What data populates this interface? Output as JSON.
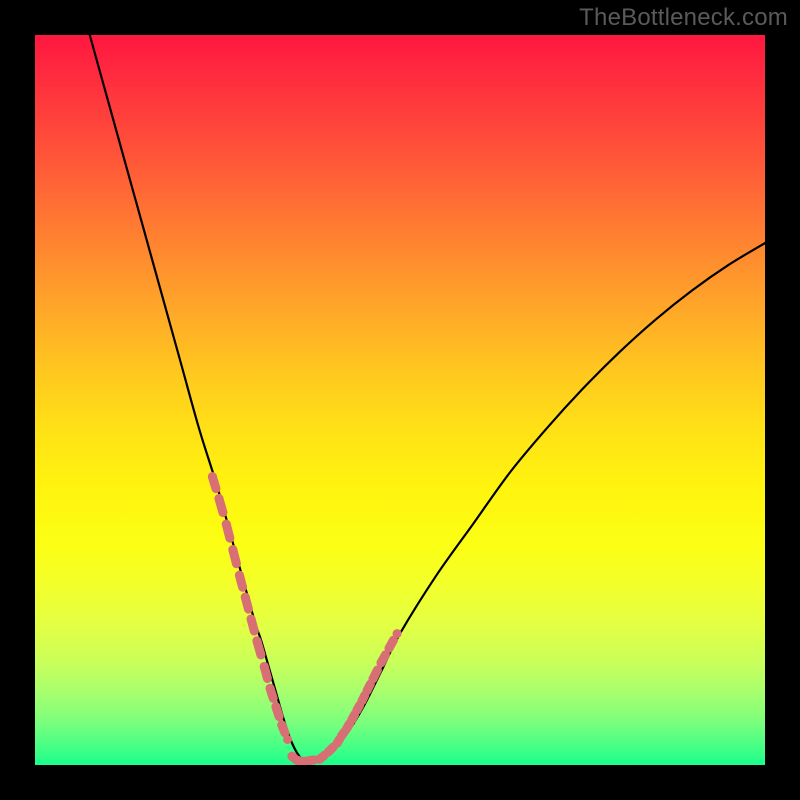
{
  "watermark": "TheBottleneck.com",
  "chart_data": {
    "type": "line",
    "title": "",
    "xlabel": "",
    "ylabel": "",
    "xlim": [
      0,
      100
    ],
    "ylim": [
      0,
      100
    ],
    "grid": false,
    "series": [
      {
        "name": "bottleneck-curve",
        "color": "#000000",
        "x": [
          7.5,
          10,
          12.5,
          15,
          17.5,
          20,
          22.5,
          25,
          27.5,
          30,
          31,
          32,
          33,
          34,
          35,
          36,
          37,
          38,
          40,
          42.5,
          45,
          47.5,
          50,
          55,
          60,
          65,
          70,
          75,
          80,
          85,
          90,
          95,
          100
        ],
        "y": [
          100,
          91,
          82,
          73,
          64,
          55,
          46,
          38,
          29,
          20,
          17,
          13.5,
          10,
          6.5,
          3.5,
          1.5,
          0.5,
          0.5,
          1.5,
          4,
          8,
          13,
          18,
          26,
          33,
          40,
          46,
          51.5,
          56.5,
          61,
          65,
          68.5,
          71.5
        ]
      },
      {
        "name": "sample-dots-left",
        "color": "#d86f74",
        "style": "dashed-dots",
        "x": [
          24.3,
          25.2,
          26.2,
          27.1,
          28.0,
          28.8,
          29.6,
          30.4,
          31.4,
          32.2,
          33.0,
          33.8,
          34.6
        ],
        "y": [
          39.5,
          36.5,
          33.0,
          29.5,
          26.0,
          23.0,
          20.0,
          17.0,
          13.5,
          10.5,
          8.0,
          5.5,
          3.5
        ]
      },
      {
        "name": "sample-dots-right",
        "color": "#d86f74",
        "style": "dashed-dots",
        "x": [
          39.0,
          40.2,
          41.4,
          42.0,
          42.7,
          43.4,
          44.1,
          44.8,
          45.5,
          46.3,
          47.4,
          48.5,
          49.6
        ],
        "y": [
          0.8,
          1.8,
          3.0,
          4.0,
          5.0,
          6.2,
          7.5,
          8.8,
          10.2,
          11.8,
          14.0,
          16.0,
          18.0
        ]
      },
      {
        "name": "sample-dots-bottom",
        "color": "#d86f74",
        "style": "dashed-dots",
        "x": [
          35.2,
          35.8,
          36.4,
          37.0,
          37.6,
          38.2
        ],
        "y": [
          1.2,
          0.7,
          0.5,
          0.5,
          0.6,
          0.7
        ]
      }
    ],
    "gradient_colors": {
      "top": "#ff173f",
      "mid_upper": "#ff8a2f",
      "mid": "#fff40e",
      "mid_lower": "#c8ff5a",
      "bottom": "#18ff8a"
    }
  }
}
